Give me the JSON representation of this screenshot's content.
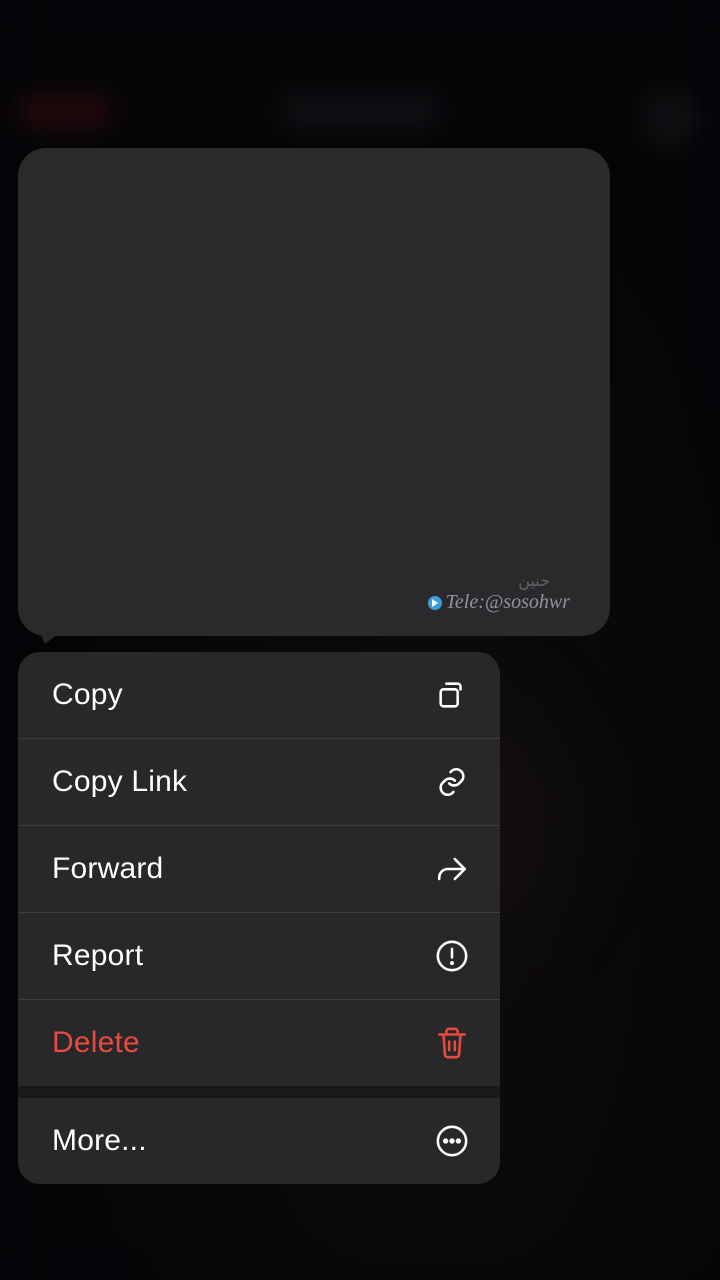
{
  "message": {
    "watermark_text": "Tele:@sosohwr"
  },
  "menu": {
    "items": [
      {
        "label": "Copy",
        "icon": "copy-icon",
        "danger": false
      },
      {
        "label": "Copy Link",
        "icon": "link-icon",
        "danger": false
      },
      {
        "label": "Forward",
        "icon": "forward-icon",
        "danger": false
      },
      {
        "label": "Report",
        "icon": "alert-icon",
        "danger": false
      },
      {
        "label": "Delete",
        "icon": "trash-icon",
        "danger": true
      }
    ],
    "more": {
      "label": "More...",
      "icon": "more-icon"
    }
  }
}
